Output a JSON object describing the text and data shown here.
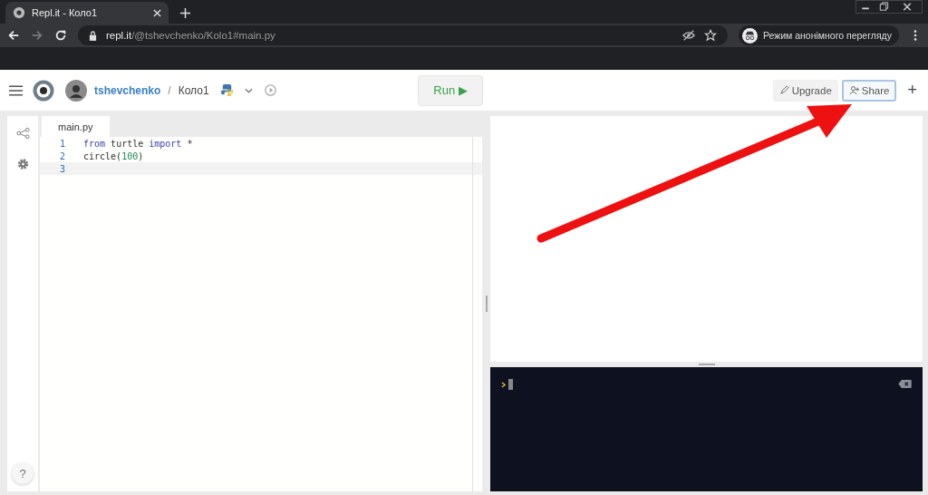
{
  "browser": {
    "tab_title": "Repl.it - Коло1",
    "url_host": "repl.it",
    "url_path": "/@tshevchenko/Kolo1#main.py",
    "incognito_label": "Режим анонімного перегляду"
  },
  "header": {
    "username": "tshevchenko",
    "separator": "/",
    "repl_name": "Коло1",
    "run_label": "Run ▶",
    "upgrade_label": "Upgrade",
    "share_label": "Share",
    "add_label": "+"
  },
  "editor": {
    "file_tab": "main.py",
    "lines": [
      {
        "number": "1",
        "tokens": [
          {
            "text": "from",
            "kind": "keyword"
          },
          {
            "text": " turtle ",
            "kind": "plain"
          },
          {
            "text": "import",
            "kind": "keyword"
          },
          {
            "text": " *",
            "kind": "plain"
          }
        ],
        "selected": false
      },
      {
        "number": "2",
        "tokens": [
          {
            "text": "circle(",
            "kind": "plain"
          },
          {
            "text": "100",
            "kind": "number"
          },
          {
            "text": ")",
            "kind": "plain"
          }
        ],
        "selected": false
      },
      {
        "number": "3",
        "selected": true
      }
    ]
  },
  "help_label": "?"
}
